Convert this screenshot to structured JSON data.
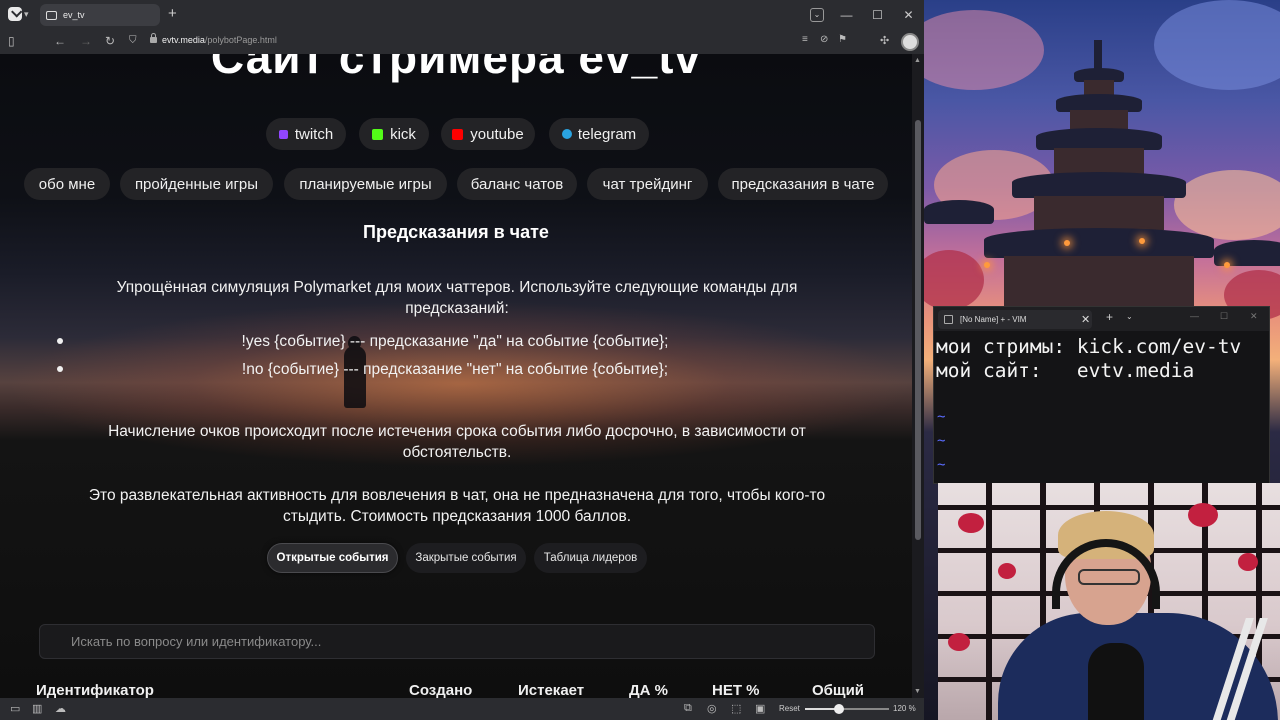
{
  "browser": {
    "tab_title": "ev_tv",
    "url_domain": "evtv.media",
    "url_path": "/polybotPage.html",
    "zoom_reset_label": "Reset",
    "zoom_level": "120 %",
    "zoom_fraction": 0.4
  },
  "page": {
    "site_title": "Сайт стримера ev_tv",
    "social_links": [
      {
        "label": "twitch",
        "color": "#9146ff"
      },
      {
        "label": "kick",
        "color": "#53fc18"
      },
      {
        "label": "youtube",
        "color": "#ff0000"
      },
      {
        "label": "telegram",
        "color": "#2aa3e0"
      }
    ],
    "nav": [
      {
        "label": "обо мне"
      },
      {
        "label": "пройденные игры"
      },
      {
        "label": "планируемые игры"
      },
      {
        "label": "баланс чатов"
      },
      {
        "label": "чат трейдинг"
      },
      {
        "label": "предсказания в чате"
      }
    ],
    "section_title": "Предсказания в чате",
    "intro": "Упрощённая симуляция Polymarket для моих чаттеров. Используйте следующие команды для предсказаний:",
    "commands": [
      "!yes {событие} --- предсказание \"да\" на событие {событие};",
      "!no {событие} --- предсказание \"нет\" на событие {событие};"
    ],
    "scoring": "Начисление очков происходит после истечения срока события либо досрочно, в зависимости от обстоятельств.",
    "disclaimer": "Это развлекательная активность для вовлечения в чат, она не предназначена для того, чтобы кого-то стыдить. Стоимость предсказания 1000 баллов.",
    "tabs": [
      {
        "label": "Открытые события",
        "active": true
      },
      {
        "label": "Закрытые события",
        "active": false
      },
      {
        "label": "Таблица лидеров",
        "active": false
      }
    ],
    "search_placeholder": "Искать по вопросу или идентификатору...",
    "table_headers": [
      "Идентификатор",
      "Создано",
      "Истекает",
      "ДА %",
      "НЕТ %",
      "Общий"
    ]
  },
  "vim": {
    "title": "[No Name] + - VIM",
    "lines": [
      "мои стримы: kick.com/ev-tv",
      "мой сайт:   evtv.media"
    ],
    "tildes": [
      "~",
      "~",
      "~"
    ]
  }
}
